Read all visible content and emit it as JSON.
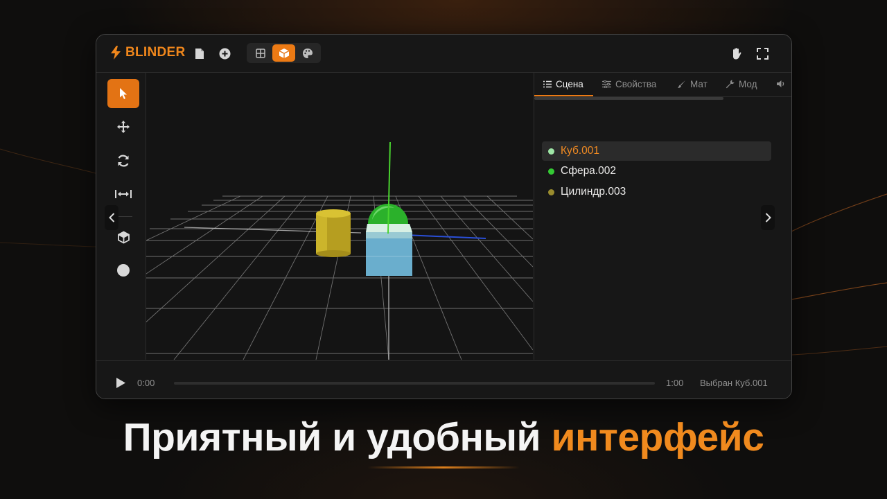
{
  "app": {
    "name": "BLINDER"
  },
  "topbar": {
    "icons": [
      "file-icon",
      "add-circle-icon"
    ],
    "modes": [
      {
        "icon": "grid-icon",
        "active": false
      },
      {
        "icon": "cube-icon",
        "active": true
      },
      {
        "icon": "palette-icon",
        "active": false
      }
    ],
    "right_icons": [
      "hand-icon",
      "fullscreen-icon"
    ]
  },
  "toolbar": {
    "tools": [
      {
        "icon": "cursor-icon",
        "active": true
      },
      {
        "icon": "move-icon",
        "active": false
      },
      {
        "icon": "rotate-icon",
        "active": false
      },
      {
        "icon": "scale-icon",
        "active": false
      },
      {
        "icon": "cube-icon",
        "active": false
      },
      {
        "icon": "sphere-icon",
        "active": false
      }
    ]
  },
  "panel": {
    "tabs": [
      {
        "label": "Сцена",
        "icon": "list-icon",
        "active": true
      },
      {
        "label": "Свойства",
        "icon": "sliders-icon",
        "active": false
      },
      {
        "label": "Мат",
        "icon": "brush-icon",
        "active": false
      },
      {
        "label": "Мод",
        "icon": "wrench-icon",
        "active": false
      },
      {
        "label": "",
        "icon": "sound-icon",
        "active": false
      }
    ],
    "objects": [
      {
        "name": "Куб.001",
        "color": "#9ee6a6",
        "selected": true
      },
      {
        "name": "Сфера.002",
        "color": "#34c934",
        "selected": false
      },
      {
        "name": "Цилиндр.003",
        "color": "#9a8c2e",
        "selected": false
      }
    ]
  },
  "timeline": {
    "current_time": "0:00",
    "end_time": "1:00",
    "status": "Выбран Куб.001",
    "progress": 0
  },
  "headline": {
    "main": "Приятный и удобный",
    "accent": "интерфейс"
  },
  "colors": {
    "accent": "#ec7a14",
    "window_bg": "#161616",
    "page_bg": "#0f0e0d"
  }
}
